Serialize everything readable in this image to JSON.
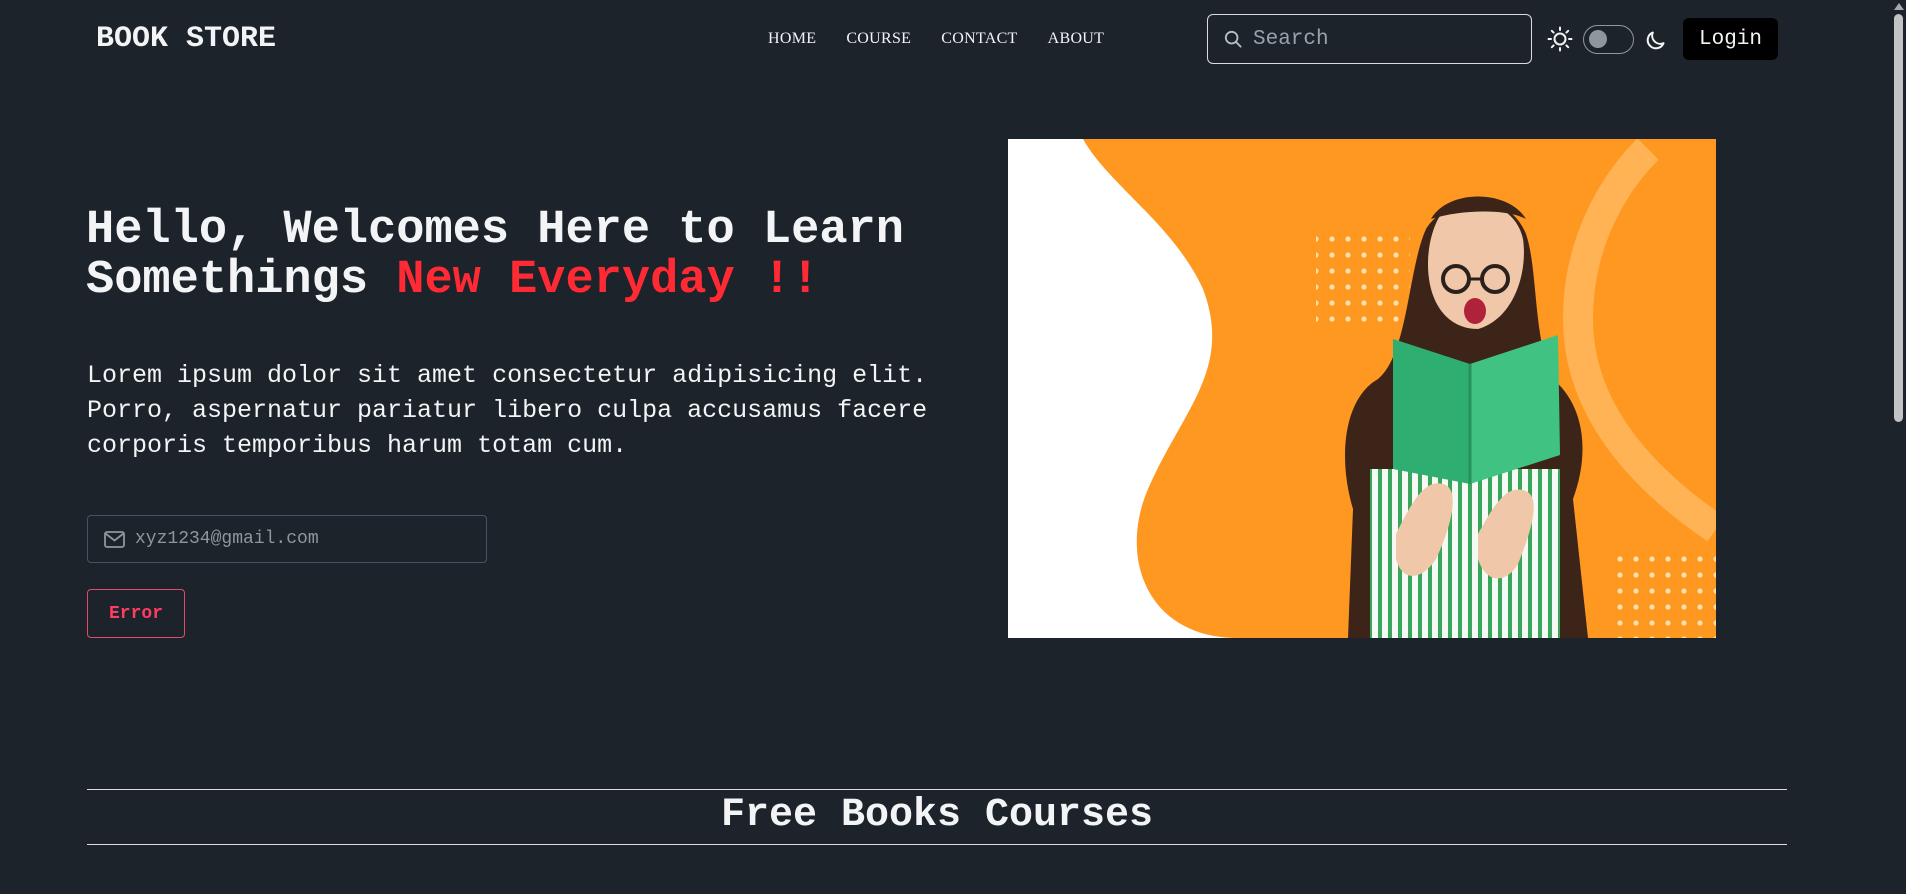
{
  "navbar": {
    "logo": "BOOK STORE",
    "links": [
      "HOME",
      "COURSE",
      "CONTACT",
      "ABOUT"
    ],
    "search_placeholder": "Search",
    "login_label": "Login"
  },
  "hero": {
    "title_main": "Hello, Welcomes Here to Learn Somethings ",
    "title_accent": "New Everyday !!",
    "description": "Lorem ipsum dolor sit amet consectetur adipisicing elit. Porro, aspernatur pariatur libero culpa accusamus facere corporis temporibus harum totam cum.",
    "email_placeholder": "xyz1234@gmail.com",
    "error_button": "Error"
  },
  "section": {
    "title": "Free Books Courses"
  },
  "colors": {
    "background": "#1d232a",
    "accent_red": "#ff2a33",
    "error_pink": "#ff3c62",
    "hero_orange": "#ff9820",
    "book_green": "#34b578"
  },
  "icons": [
    "search-icon",
    "sun-icon",
    "moon-icon",
    "mail-icon"
  ]
}
